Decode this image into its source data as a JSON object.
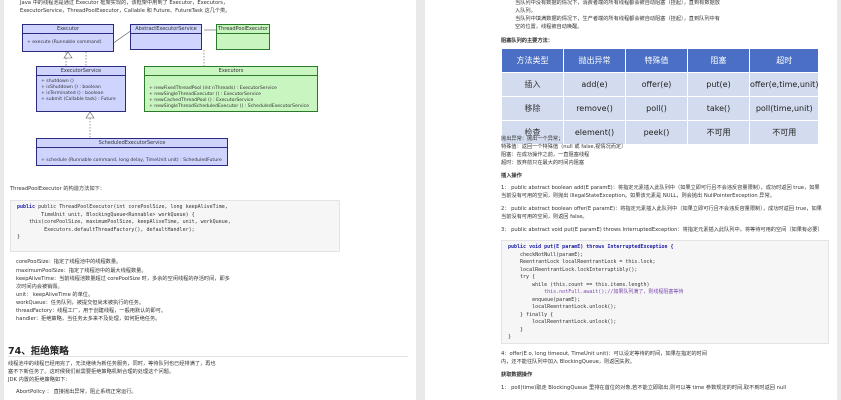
{
  "left": {
    "intro": [
      "Java 中的线程池是通过 Executor 框架实现的，该框架中用到了 Executor，Executors，",
      "ExecutorService，ThreadPoolExecutor，Callable 和 Future、FutureTask 这几个类。"
    ],
    "uml": {
      "executor": {
        "title": "Executor",
        "rows": [
          "+ execute (Runnable command)"
        ]
      },
      "abstract": {
        "title": "AbstractExecutorService",
        "rows": []
      },
      "tpe": {
        "title": "ThreadPoolExecutor",
        "rows": []
      },
      "service": {
        "title": "ExecutorService",
        "rows": [
          "+ shutdown ()",
          "+ isShutdown ()          : boolean",
          "+ isTerminated ()         : boolean",
          "+ submit (Callable task)   : Future"
        ]
      },
      "executors": {
        "title": "Executors",
        "rows": [
          "+ newFixedThreadPool (int nThreads)          : ExecutorService",
          "+ newSingleThreadExecutor ()                 : ExecutorService",
          "+ newCachedThreadPool ()                     : ExecutorService",
          "+ newSingleThreadScheduledExecutor ()        : ScheduledExecutorService"
        ]
      },
      "scheduled": {
        "title": "ScheduledExecutorService",
        "rows": [
          "+ schedule (Runnable command, long delay, TimeUnit unit)   : ScheduledFuture"
        ]
      }
    },
    "ctor_caption": "ThreadPoolExecutor 的构造方法如下：",
    "ctor_code": [
      "public ThreadPoolExecutor(int corePoolSize, long keepAliveTime,",
      "        TimeUnit unit, BlockingQueue<Runnable> workQueue) {",
      "",
      "    this(corePoolSize, maximumPoolSize, keepAliveTime, unit, workQueue,",
      "         Executors.defaultThreadFactory(), defaultHandler);",
      "}"
    ],
    "params": [
      "corePoolSize：指定了线程池中的线程数量。",
      "maximumPoolSize：指定了线程池中的最大线程数量。",
      "keepAliveTime：当前线程池数量超过 corePoolSize 时，多余的空闲线程的存活时间，即多",
      "   次时间内会被销毁。",
      "unit：  keepAliveTime 的单位。",
      "workQueue：任务队列，被提交但尚未被执行的任务。",
      "threadFactory：线程工厂，用于创建线程，一般用默认的即可。",
      "handler：拒绝策略，当任务太多来不及处理，如何拒绝任务。"
    ],
    "section_title": "74、拒绝策略",
    "section_body": [
      "线程池中的线程已经用完了，无法继续为新任务服务，同时，等待队列也已经排满了，再也",
      "塞不下新任务了。这时候我们就需要拒绝策略机制合理的处理这个问题。",
      "JDK 内置的拒绝策略如下："
    ],
    "last_item": "AbortPolicy ：  直接抛出异常，阻止系统正常运行。"
  },
  "right": {
    "top_items": [
      "当队列中没有数据的情况下，消费者端的所有线程都会被自动阻塞（挂起），直到有数据放",
      "入队列。",
      "当队列中填满数据的情况下，生产者端的所有线程都会被自动阻塞（挂起），直到队列中有",
      "空的位置，线程被自动唤醒。"
    ],
    "methods_title": "阻塞队列的主要方法：",
    "ops_table": {
      "header": [
        "方法类型",
        "抛出异常",
        "特殊值",
        "阻塞",
        "超时"
      ],
      "rows": [
        [
          "插入",
          "add(e)",
          "offer(e)",
          "put(e)",
          "offer(e,time,unit)"
        ],
        [
          "移除",
          "remove()",
          "poll()",
          "take()",
          "poll(time,unit)"
        ],
        [
          "检查",
          "element()",
          "peek()",
          "不可用",
          "不可用"
        ]
      ]
    },
    "legend": [
      "抛出异常：抛出一个异常；",
      "特殊值：返回一个特殊值（null 或 false,视情况而定）",
      "阻塞：在成功操作之前，一直阻塞线程",
      "超时：放弃前只在最大的时间内阻塞"
    ],
    "insert_title": "插入操作",
    "insert_items": [
      "1：  public abstract boolean add(E paramE)：将指定元素插入此队列中（如果立即可行且不会违反容量限制），成功时返回 true，如果",
      "当前没有可用的空间，则抛出 IllegalStateException。如果该元素是 NULL，则会抛出 NullPointerException 异常。",
      "2：  public abstract boolean offer(E paramE)：将指定元素插入此队列中（如果立即可行且不会违反容量限制），成功时返回 true，如果",
      "当前没有可用的空间，则返回 false。",
      "3：  public abstract void put(E paramE) throws InterruptedException：将指定元素插入此队列中，将等待可用的空间（如果有必要）"
    ],
    "put_code": [
      "public void put(E paramE) throws InterruptedException {",
      "    checkNotNull(paramE);",
      "    ReentrantLock localReentrantLock = this.lock;",
      "    localReentrantLock.lockInterruptibly();",
      "    try {",
      "        while (this.count == this.items.length)",
      "            this.notFull.await();//如果队列满了，则线程阻塞等待",
      "        enqueue(paramE);",
      "        localReentrantLock.unlock();",
      "    } finally {",
      "        localReentrantLock.unlock();",
      "    }",
      "}"
    ],
    "offer_note": [
      "4：offer(E o, long timeout, TimeUnit unit)：可以设定等待的时间，如果在指定的时间",
      "内，还不能往队列中加入 BlockingQueue，则返回失败。"
    ],
    "fetch_title": "获取数据操作",
    "fetch_item": "1：  poll(time)取走 BlockingQueue 里排在首位的对象,若不能立即取出,则可以等 time 参数规定的时间,取不到时返回 null"
  }
}
